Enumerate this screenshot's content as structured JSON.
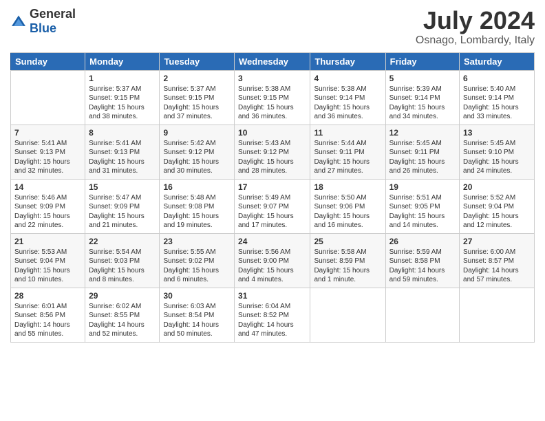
{
  "header": {
    "logo_general": "General",
    "logo_blue": "Blue",
    "month_year": "July 2024",
    "location": "Osnago, Lombardy, Italy"
  },
  "days_of_week": [
    "Sunday",
    "Monday",
    "Tuesday",
    "Wednesday",
    "Thursday",
    "Friday",
    "Saturday"
  ],
  "weeks": [
    [
      {
        "day": "",
        "sunrise": "",
        "sunset": "",
        "daylight": ""
      },
      {
        "day": "1",
        "sunrise": "Sunrise: 5:37 AM",
        "sunset": "Sunset: 9:15 PM",
        "daylight": "Daylight: 15 hours and 38 minutes."
      },
      {
        "day": "2",
        "sunrise": "Sunrise: 5:37 AM",
        "sunset": "Sunset: 9:15 PM",
        "daylight": "Daylight: 15 hours and 37 minutes."
      },
      {
        "day": "3",
        "sunrise": "Sunrise: 5:38 AM",
        "sunset": "Sunset: 9:15 PM",
        "daylight": "Daylight: 15 hours and 36 minutes."
      },
      {
        "day": "4",
        "sunrise": "Sunrise: 5:38 AM",
        "sunset": "Sunset: 9:14 PM",
        "daylight": "Daylight: 15 hours and 36 minutes."
      },
      {
        "day": "5",
        "sunrise": "Sunrise: 5:39 AM",
        "sunset": "Sunset: 9:14 PM",
        "daylight": "Daylight: 15 hours and 34 minutes."
      },
      {
        "day": "6",
        "sunrise": "Sunrise: 5:40 AM",
        "sunset": "Sunset: 9:14 PM",
        "daylight": "Daylight: 15 hours and 33 minutes."
      }
    ],
    [
      {
        "day": "7",
        "sunrise": "Sunrise: 5:41 AM",
        "sunset": "Sunset: 9:13 PM",
        "daylight": "Daylight: 15 hours and 32 minutes."
      },
      {
        "day": "8",
        "sunrise": "Sunrise: 5:41 AM",
        "sunset": "Sunset: 9:13 PM",
        "daylight": "Daylight: 15 hours and 31 minutes."
      },
      {
        "day": "9",
        "sunrise": "Sunrise: 5:42 AM",
        "sunset": "Sunset: 9:12 PM",
        "daylight": "Daylight: 15 hours and 30 minutes."
      },
      {
        "day": "10",
        "sunrise": "Sunrise: 5:43 AM",
        "sunset": "Sunset: 9:12 PM",
        "daylight": "Daylight: 15 hours and 28 minutes."
      },
      {
        "day": "11",
        "sunrise": "Sunrise: 5:44 AM",
        "sunset": "Sunset: 9:11 PM",
        "daylight": "Daylight: 15 hours and 27 minutes."
      },
      {
        "day": "12",
        "sunrise": "Sunrise: 5:45 AM",
        "sunset": "Sunset: 9:11 PM",
        "daylight": "Daylight: 15 hours and 26 minutes."
      },
      {
        "day": "13",
        "sunrise": "Sunrise: 5:45 AM",
        "sunset": "Sunset: 9:10 PM",
        "daylight": "Daylight: 15 hours and 24 minutes."
      }
    ],
    [
      {
        "day": "14",
        "sunrise": "Sunrise: 5:46 AM",
        "sunset": "Sunset: 9:09 PM",
        "daylight": "Daylight: 15 hours and 22 minutes."
      },
      {
        "day": "15",
        "sunrise": "Sunrise: 5:47 AM",
        "sunset": "Sunset: 9:09 PM",
        "daylight": "Daylight: 15 hours and 21 minutes."
      },
      {
        "day": "16",
        "sunrise": "Sunrise: 5:48 AM",
        "sunset": "Sunset: 9:08 PM",
        "daylight": "Daylight: 15 hours and 19 minutes."
      },
      {
        "day": "17",
        "sunrise": "Sunrise: 5:49 AM",
        "sunset": "Sunset: 9:07 PM",
        "daylight": "Daylight: 15 hours and 17 minutes."
      },
      {
        "day": "18",
        "sunrise": "Sunrise: 5:50 AM",
        "sunset": "Sunset: 9:06 PM",
        "daylight": "Daylight: 15 hours and 16 minutes."
      },
      {
        "day": "19",
        "sunrise": "Sunrise: 5:51 AM",
        "sunset": "Sunset: 9:05 PM",
        "daylight": "Daylight: 15 hours and 14 minutes."
      },
      {
        "day": "20",
        "sunrise": "Sunrise: 5:52 AM",
        "sunset": "Sunset: 9:04 PM",
        "daylight": "Daylight: 15 hours and 12 minutes."
      }
    ],
    [
      {
        "day": "21",
        "sunrise": "Sunrise: 5:53 AM",
        "sunset": "Sunset: 9:04 PM",
        "daylight": "Daylight: 15 hours and 10 minutes."
      },
      {
        "day": "22",
        "sunrise": "Sunrise: 5:54 AM",
        "sunset": "Sunset: 9:03 PM",
        "daylight": "Daylight: 15 hours and 8 minutes."
      },
      {
        "day": "23",
        "sunrise": "Sunrise: 5:55 AM",
        "sunset": "Sunset: 9:02 PM",
        "daylight": "Daylight: 15 hours and 6 minutes."
      },
      {
        "day": "24",
        "sunrise": "Sunrise: 5:56 AM",
        "sunset": "Sunset: 9:00 PM",
        "daylight": "Daylight: 15 hours and 4 minutes."
      },
      {
        "day": "25",
        "sunrise": "Sunrise: 5:58 AM",
        "sunset": "Sunset: 8:59 PM",
        "daylight": "Daylight: 15 hours and 1 minute."
      },
      {
        "day": "26",
        "sunrise": "Sunrise: 5:59 AM",
        "sunset": "Sunset: 8:58 PM",
        "daylight": "Daylight: 14 hours and 59 minutes."
      },
      {
        "day": "27",
        "sunrise": "Sunrise: 6:00 AM",
        "sunset": "Sunset: 8:57 PM",
        "daylight": "Daylight: 14 hours and 57 minutes."
      }
    ],
    [
      {
        "day": "28",
        "sunrise": "Sunrise: 6:01 AM",
        "sunset": "Sunset: 8:56 PM",
        "daylight": "Daylight: 14 hours and 55 minutes."
      },
      {
        "day": "29",
        "sunrise": "Sunrise: 6:02 AM",
        "sunset": "Sunset: 8:55 PM",
        "daylight": "Daylight: 14 hours and 52 minutes."
      },
      {
        "day": "30",
        "sunrise": "Sunrise: 6:03 AM",
        "sunset": "Sunset: 8:54 PM",
        "daylight": "Daylight: 14 hours and 50 minutes."
      },
      {
        "day": "31",
        "sunrise": "Sunrise: 6:04 AM",
        "sunset": "Sunset: 8:52 PM",
        "daylight": "Daylight: 14 hours and 47 minutes."
      },
      {
        "day": "",
        "sunrise": "",
        "sunset": "",
        "daylight": ""
      },
      {
        "day": "",
        "sunrise": "",
        "sunset": "",
        "daylight": ""
      },
      {
        "day": "",
        "sunrise": "",
        "sunset": "",
        "daylight": ""
      }
    ]
  ]
}
